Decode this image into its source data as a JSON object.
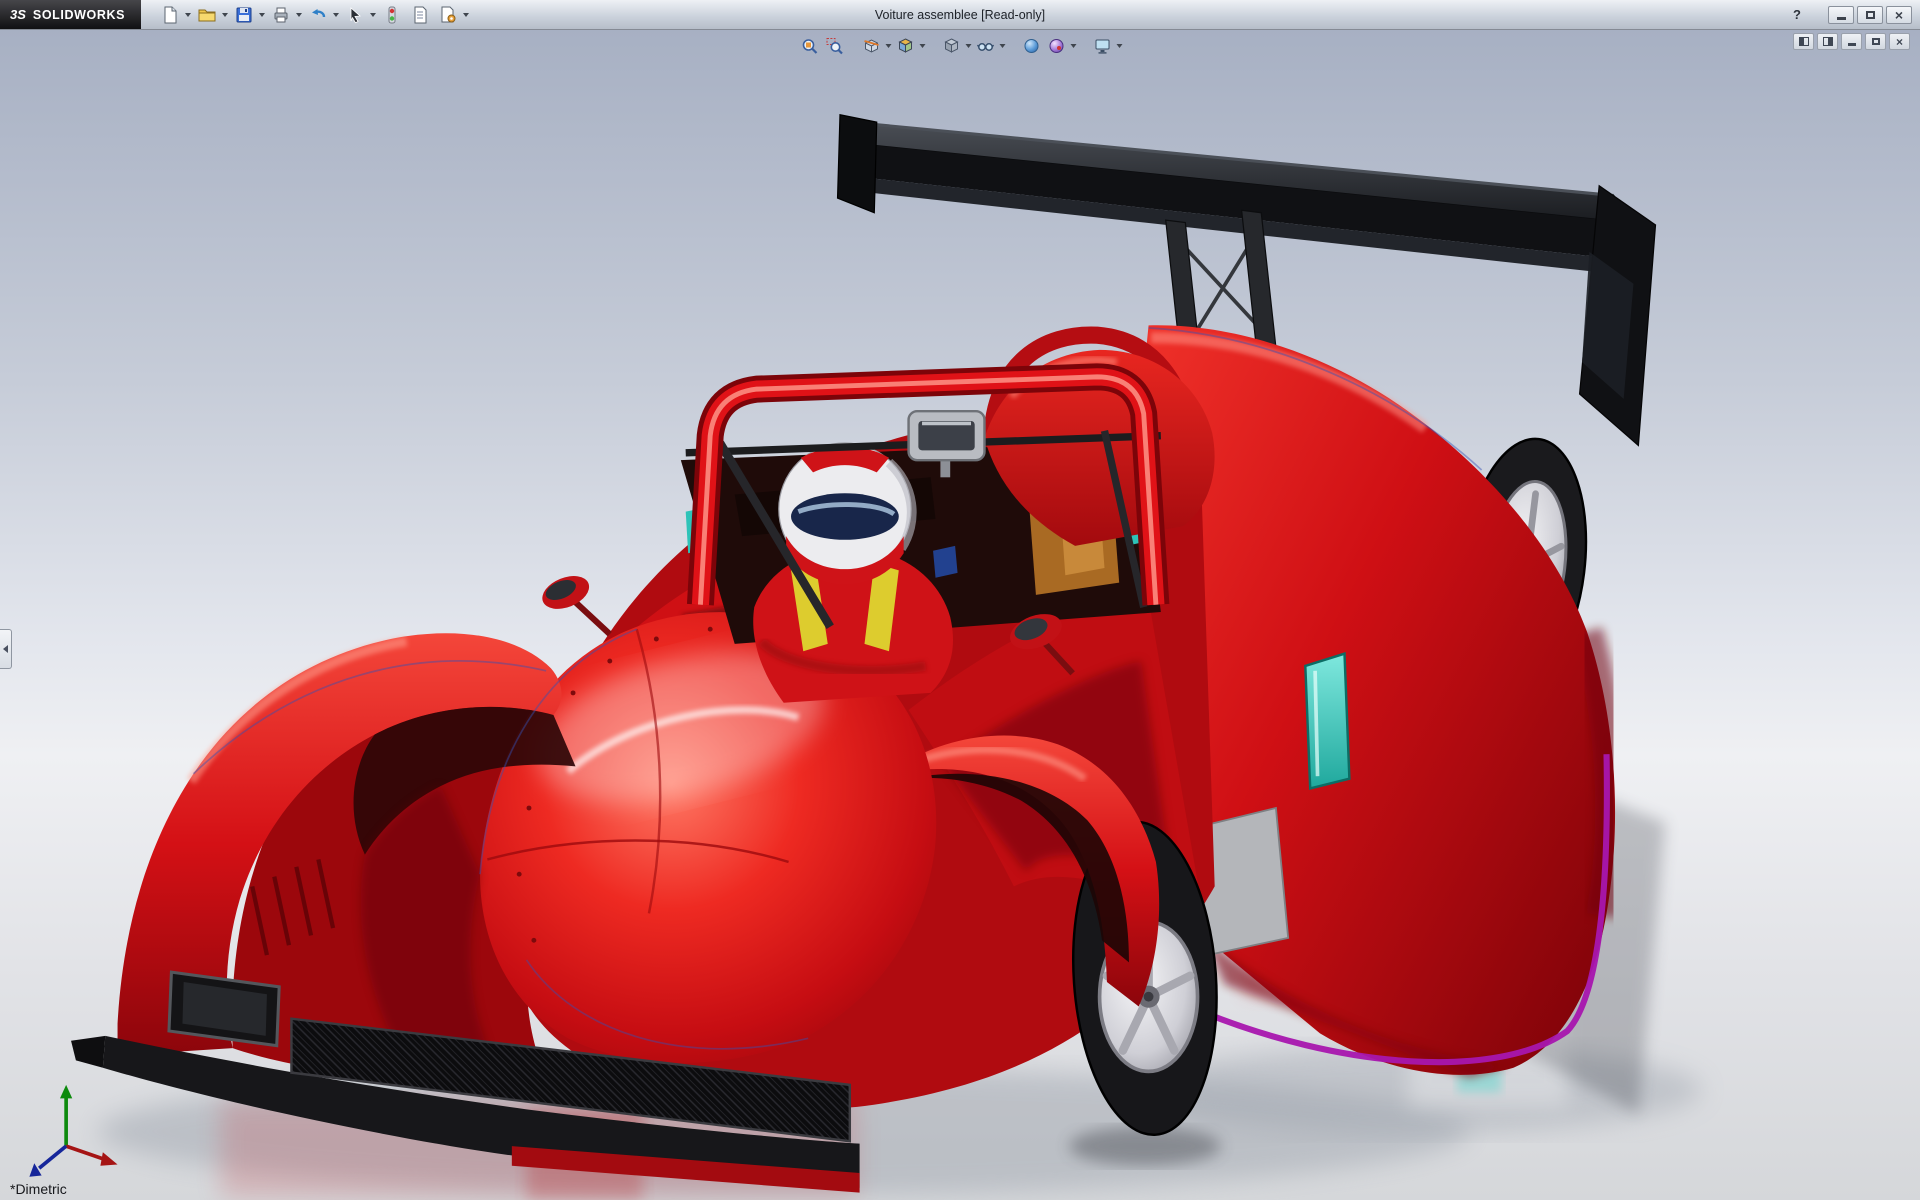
{
  "window": {
    "logo_mark": "3S",
    "brand": "SOLIDWORKS",
    "title": "Voiture assemblee [Read-only]",
    "controls": {
      "help": "?",
      "minimize": "Minimize",
      "maximize": "Maximize",
      "close": "Close"
    }
  },
  "main_toolbar": {
    "buttons": [
      {
        "label": "New"
      },
      {
        "label": "Open"
      },
      {
        "label": "Save"
      },
      {
        "label": "Print"
      },
      {
        "label": "Undo"
      },
      {
        "label": "Select"
      },
      {
        "label": "Rebuild"
      },
      {
        "label": "File Properties"
      },
      {
        "label": "Options"
      }
    ]
  },
  "heads_up_toolbar": {
    "buttons": [
      {
        "label": "Zoom to Fit"
      },
      {
        "label": "Zoom to Area"
      },
      {
        "label": "Section View"
      },
      {
        "label": "View Orientation"
      },
      {
        "label": "Display Style"
      },
      {
        "label": "Hide/Show Items"
      },
      {
        "label": "Edit Appearance"
      },
      {
        "label": "Apply Scene"
      },
      {
        "label": "View Settings"
      }
    ]
  },
  "document_controls": {
    "buttons": [
      {
        "label": "Viewport Layout"
      },
      {
        "label": "Split View"
      },
      {
        "label": "Minimize Document"
      },
      {
        "label": "Restore Document"
      },
      {
        "label": "Close Document"
      }
    ]
  },
  "viewport": {
    "view_orientation_label": "*Dimetric",
    "model": {
      "name": "Voiture assemblee",
      "colors": {
        "body_red": "#d8111a",
        "wing_black": "#15161a",
        "rim_silver": "#c9c9cf",
        "cockpit_teal": "#35cfc4",
        "lower_stripe_magenta": "#a816ae",
        "harness_yellow": "#ddcc2e"
      }
    }
  }
}
